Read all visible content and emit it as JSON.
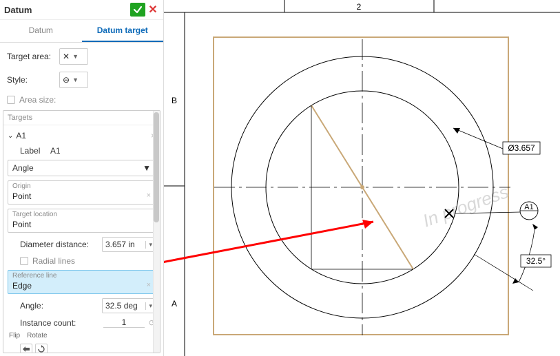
{
  "panel": {
    "title": "Datum",
    "tabs": {
      "datum": "Datum",
      "datum_target": "Datum target"
    },
    "target_area_label": "Target area:",
    "style_label": "Style:",
    "area_size_label": "Area size:",
    "targets_header": "Targets",
    "node": {
      "name": "A1",
      "label_field_label": "Label",
      "label_value": "A1",
      "angle_select": "Angle",
      "origin_label": "Origin",
      "origin_value": "Point",
      "target_loc_label": "Target location",
      "target_loc_value": "Point",
      "diameter_distance_label": "Diameter distance:",
      "diameter_distance_value": "3.657 in",
      "radial_lines_label": "Radial lines",
      "reference_line_label": "Reference line",
      "reference_line_value": "Edge",
      "angle_label": "Angle:",
      "angle_value": "32.5 deg",
      "instance_count_label": "Instance count:",
      "instance_count_value": "1",
      "flip_label": "Flip",
      "rotate_label": "Rotate"
    }
  },
  "drawing": {
    "col_label": "2",
    "row_labels": {
      "top": "B",
      "bottom": "A"
    },
    "diameter_callout": "Ø3.657",
    "angle_callout": "32.5°",
    "datum_balloon": "A1",
    "watermark": "In progress"
  },
  "chart_data": {
    "type": "diagram",
    "title": "Datum target on circular feature",
    "outer_diameter": 3.657,
    "datum_target_angle_deg": 32.5,
    "datum_label": "A1",
    "units": "in"
  }
}
